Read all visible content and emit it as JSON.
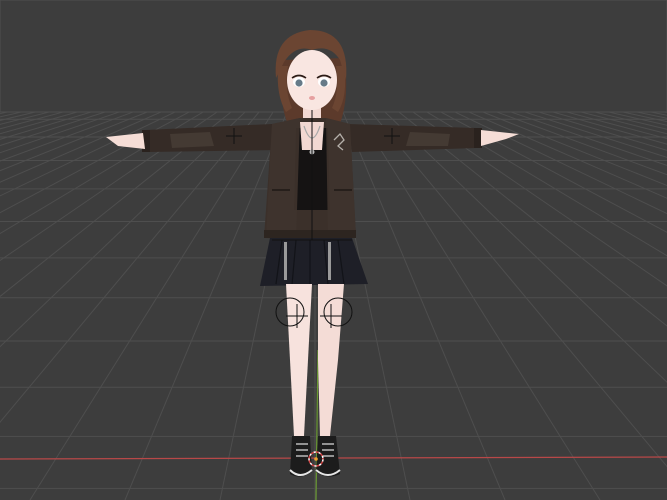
{
  "viewport": {
    "background_color": "#3d3d3d",
    "grid_line_color": "#4e4e4e",
    "x_axis_color": "#b84848",
    "y_axis_color": "#6a9a32"
  },
  "model": {
    "pose": "t-pose",
    "hair_color": "#6b4532",
    "skin_color": "#f7e2dd",
    "jacket_color": "#3b302a",
    "top_color": "#151313",
    "skirt_color": "#1e1f27",
    "shoe_color": "#1c1c1c"
  },
  "icons": {
    "ik_target": "crosshair-icon",
    "origin": "origin-point-icon"
  }
}
